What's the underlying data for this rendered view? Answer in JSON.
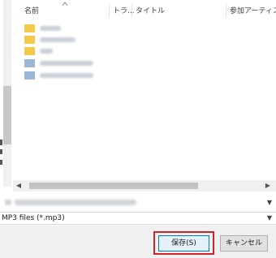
{
  "columns": {
    "name": "名前",
    "track": "トラ...",
    "title": "タイトル",
    "artist": "参加アーティスト"
  },
  "icons": {
    "sort": "sort-up-icon",
    "folder": "folder-icon",
    "file": "audio-file-icon",
    "scroll_left": "chevron-left-icon",
    "scroll_right": "chevron-right-icon",
    "dropdown": "chevron-down-icon"
  },
  "colors": {
    "folder": "#f3c94a",
    "highlight": "#d1222a",
    "primary_border": "#0078d7"
  },
  "filetype": {
    "value": "MP3 files (*.mp3)"
  },
  "buttons": {
    "save": "保存(S)",
    "cancel": "キャンセル"
  }
}
